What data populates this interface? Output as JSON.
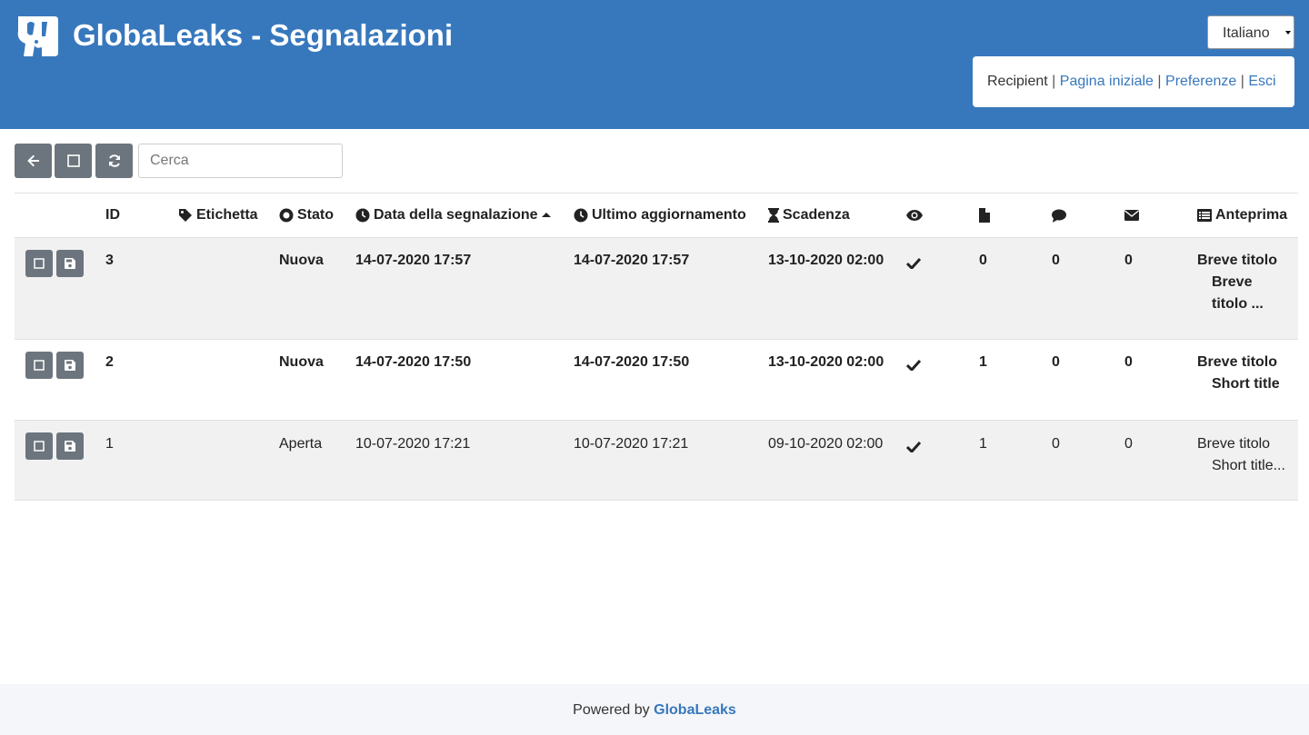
{
  "header": {
    "title": "GlobaLeaks - Segnalazioni",
    "brand_color": "#3778bd",
    "language": {
      "selected": "Italiano"
    },
    "user": {
      "role": "Recipient",
      "separator": "|",
      "links": [
        "Pagina iniziale",
        "Preferenze",
        "Esci"
      ]
    }
  },
  "toolbar": {
    "back_icon": "arrow-left-icon",
    "select_all_icon": "checkbox-icon",
    "refresh_icon": "refresh-icon",
    "search_placeholder": "Cerca"
  },
  "table": {
    "columns": {
      "id": "ID",
      "label": "Etichetta",
      "status": "Stato",
      "date": "Data della segnalazione",
      "updated": "Ultimo aggiornamento",
      "expiry": "Scadenza",
      "preview": "Anteprima"
    },
    "icon_columns": [
      "eye-icon",
      "file-icon",
      "comment-icon",
      "envelope-icon"
    ],
    "rows": [
      {
        "id": "3",
        "label": "",
        "status": "Nuova",
        "date": "14-07-2020 17:57",
        "updated": "14-07-2020 17:57",
        "expiry": "13-10-2020 02:00",
        "files": "0",
        "comments": "0",
        "messages": "0",
        "preview": [
          "Breve titolo",
          "Breve",
          "titolo ..."
        ]
      },
      {
        "id": "2",
        "label": "",
        "status": "Nuova",
        "date": "14-07-2020 17:50",
        "updated": "14-07-2020 17:50",
        "expiry": "13-10-2020 02:00",
        "files": "1",
        "comments": "0",
        "messages": "0",
        "preview": [
          "Breve titolo",
          "Short title"
        ]
      },
      {
        "id": "1",
        "label": "",
        "status": "Aperta",
        "date": "10-07-2020 17:21",
        "updated": "10-07-2020 17:21",
        "expiry": "09-10-2020 02:00",
        "files": "1",
        "comments": "0",
        "messages": "0",
        "preview": [
          "Breve titolo",
          "Short title..."
        ]
      }
    ]
  },
  "footer": {
    "powered_by": "Powered by",
    "brand": "GlobaLeaks"
  }
}
